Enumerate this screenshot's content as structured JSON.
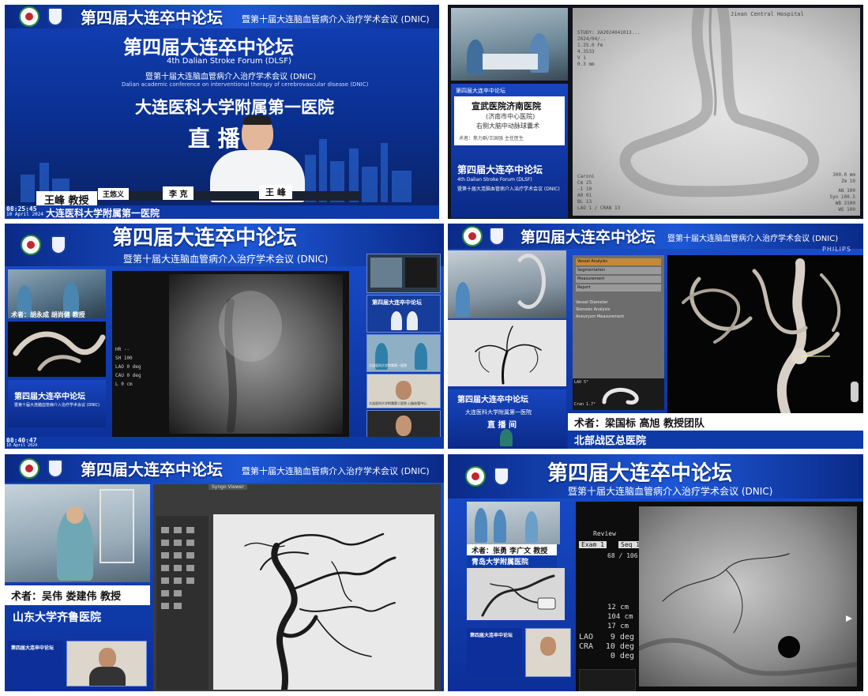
{
  "forum": {
    "title_cn": "第四届大连卒中论坛",
    "subtitle_cn": "暨第十届大连脑血管病介入治疗学术会议 (DNIC)",
    "title_en": "4th Dalian Stroke Forum (DLSF)",
    "subtitle_en": "Dalian academic conference on interventional therapy of cerebrovascular disease (DNIC)"
  },
  "p1": {
    "hospital": "大连医科大学附属第一医院",
    "live": "直 播 间",
    "speaker": "王峰 教授",
    "nameplate": "王 峰",
    "nameplate2": "李 克",
    "nameplate3": "王悠义",
    "time": "08:25:45",
    "date": "10 April 2024",
    "ticker": "大连医科大学附属第一医院"
  },
  "p2": {
    "hospital_label": "Jinan Central Hospital",
    "study_lines": [
      "STUDY: XA2024041013...",
      "2024/04/..",
      "1.25.0 Fm",
      "4.3533",
      "V 1",
      "0.3 mm"
    ],
    "right_lines": [
      "300.0 mm",
      "Zm 10"
    ],
    "bottom_lines": [
      "Caroni",
      "Cm 25",
      "-1 10",
      "A0 01",
      "BL 13",
      "LAO 1 / CRAN 13"
    ],
    "bottom_right": [
      "AN 100",
      "Syn 100.5",
      "WB 3100",
      "WS 100"
    ],
    "card_title": "宣武医院济南医院",
    "card_sub": "(济南市中心医院)",
    "card_topic": "右侧大脑中动脉球囊术",
    "card_author": "术者：焦力群/王国强 主任医生",
    "card_forum": "第四届大连卒中论坛"
  },
  "p3": {
    "surgeons": "术者：胡永成 胡尚健 教授",
    "time": "08:40:47",
    "date": "10 April 2024",
    "readouts": [
      "HR --",
      "SH 100",
      "LAO 0 deg",
      "CAU 0 deg",
      "L 0 cm"
    ],
    "side_labels": [
      "大连医科大学附属第一医院",
      "大连医科大学附属第二医院 心脑血管中心"
    ]
  },
  "p4": {
    "brand": "PHILIPS",
    "surgeons": "术者：梁国标 高旭 教授团队",
    "hospital": "北部战区总医院",
    "lao": "LAO 5°",
    "cran": "Cran 1.7°",
    "menu_tabs": [
      "Vessel Analysis",
      "Segmentation",
      "Measurement",
      "Report"
    ],
    "menu_rows": [
      "Vessel Diameter",
      "Stenosis Analysis",
      "Aneurysm Measurement"
    ],
    "live": "直 播 间",
    "mini_hospital": "大连医科大学附属第一医院"
  },
  "p5": {
    "surgeons": "术者：吴伟 娄建伟 教授",
    "hospital": "山东大学齐鲁医院",
    "tab": "Syngo Viewer"
  },
  "p6": {
    "surgeons": "术者：张勇 李广文 教授",
    "hospital": "青岛大学附属医院",
    "review": "Review",
    "exam": "Exam 1",
    "seq": "Seq 14",
    "frame": "68 / 106",
    "cm1": "12 cm",
    "cm2": "104 cm",
    "cm3": "17 cm",
    "lao": "LAO",
    "lao_val": "9 deg",
    "cra": "CRA",
    "cra_val": "10 deg",
    "zero_val": "0 deg"
  },
  "colors": {
    "banner": "#1d57d6",
    "deep": "#0b2a78",
    "ticker": "#0e3aa8"
  }
}
